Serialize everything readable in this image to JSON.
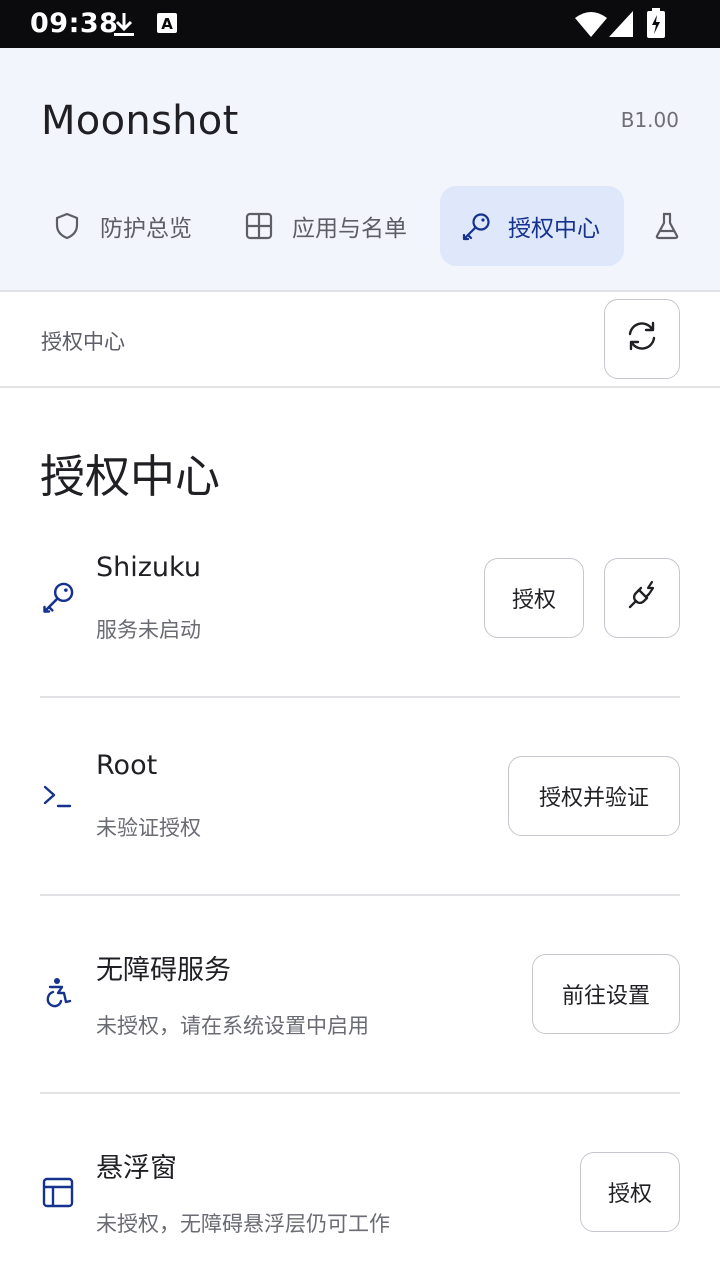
{
  "status_bar": {
    "time": "09:38",
    "icons": [
      "download-icon",
      "keyboard-a-icon",
      "wifi-icon",
      "signal-icon",
      "battery-charging-icon"
    ]
  },
  "app": {
    "title": "Moonshot",
    "version": "B1.00"
  },
  "tabs": [
    {
      "label": "防护总览",
      "icon": "shield-icon",
      "active": false
    },
    {
      "label": "应用与名单",
      "icon": "grid-icon",
      "active": false
    },
    {
      "label": "授权中心",
      "icon": "key-icon",
      "active": true
    },
    {
      "label": "",
      "icon": "flask-icon",
      "active": false
    }
  ],
  "toolbar": {
    "label": "授权中心",
    "refresh_icon": "refresh-icon"
  },
  "page": {
    "heading": "授权中心"
  },
  "items": [
    {
      "title": "Shizuku",
      "subtitle": "服务未启动",
      "icon": "key-icon",
      "buttons": [
        "授权"
      ],
      "extra_icon": "plug-icon"
    },
    {
      "title": "Root",
      "subtitle": "未验证授权",
      "icon": "terminal-icon",
      "buttons": [
        "授权并验证"
      ]
    },
    {
      "title": "无障碍服务",
      "subtitle": "未授权，请在系统设置中启用",
      "icon": "accessibility-icon",
      "buttons": [
        "前往设置"
      ]
    },
    {
      "title": "悬浮窗",
      "subtitle": "未授权，无障碍悬浮层仍可工作",
      "icon": "window-icon",
      "buttons": [
        "授权"
      ]
    }
  ],
  "colors": {
    "accent": "#16328f",
    "header_bg": "#f3f5fc",
    "active_tab_bg": "#dfe7fb",
    "status_bar_bg": "#0b0b0e"
  }
}
